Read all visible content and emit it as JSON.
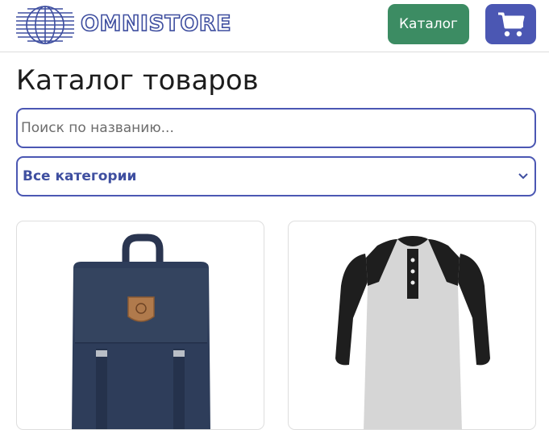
{
  "header": {
    "logo_text": "OMNISTORE",
    "catalog_button_label": "Каталог",
    "cart_icon": "cart-icon",
    "logo_icon": "globe-logo-icon"
  },
  "main": {
    "title": "Каталог товаров",
    "search": {
      "placeholder": "Поиск по названию...",
      "value": ""
    },
    "category_select": {
      "selected": "Все категории"
    },
    "products": [
      {
        "image": "backpack",
        "image_alt": ""
      },
      {
        "image": "raglan-henley-shirt",
        "image_alt": ""
      }
    ]
  },
  "colors": {
    "brand_blue": "#4b57b3",
    "catalog_green": "#3c8c63",
    "logo_blue": "#3f4fa0"
  }
}
